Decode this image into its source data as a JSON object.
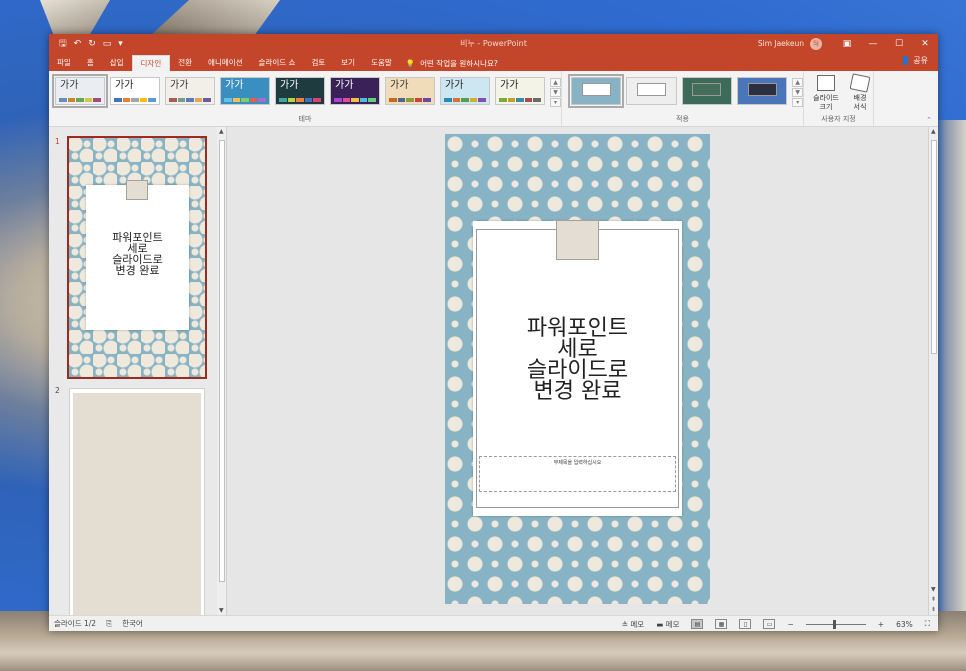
{
  "window": {
    "doc_title": "비누  -  PowerPoint",
    "user_name": "Sim Jaekeun",
    "user_initials": "SJ",
    "qat": [
      "save-icon",
      "undo-icon",
      "redo-icon",
      "present-icon",
      "customize-icon"
    ],
    "controls": [
      "ribbon-display-icon",
      "minimize-icon",
      "maximize-icon",
      "close-icon"
    ]
  },
  "tabs": [
    {
      "label": "파일",
      "active": false
    },
    {
      "label": "홈",
      "active": false
    },
    {
      "label": "삽입",
      "active": false
    },
    {
      "label": "디자인",
      "active": true
    },
    {
      "label": "전환",
      "active": false
    },
    {
      "label": "애니메이션",
      "active": false
    },
    {
      "label": "슬라이드 쇼",
      "active": false
    },
    {
      "label": "검토",
      "active": false
    },
    {
      "label": "보기",
      "active": false
    },
    {
      "label": "도움말",
      "active": false
    }
  ],
  "tell_me": "어떤 작업을 원하시나요?",
  "share": "공유",
  "ribbon": {
    "themes_label": "테마",
    "variants_label": "적용",
    "customize_label": "사용자 지정",
    "theme_thumb_text": "가가",
    "themes": [
      {
        "bg": "#eaeef2",
        "fg": "#333333",
        "sw": [
          "#6a8fb5",
          "#c6862b",
          "#6aa35a",
          "#d0c94a",
          "#a04c7a"
        ]
      },
      {
        "bg": "#ffffff",
        "fg": "#222222",
        "sw": [
          "#4472c4",
          "#ed7d31",
          "#a5a5a5",
          "#ffc000",
          "#5b9bd5"
        ]
      },
      {
        "bg": "#f2efe9",
        "fg": "#333333",
        "sw": [
          "#a65d57",
          "#7b9c8a",
          "#5a7bb5",
          "#e0a94d",
          "#6a5d9c"
        ]
      },
      {
        "bg": "#3a8fc0",
        "fg": "#ffffff",
        "sw": [
          "#63c0e6",
          "#f0c050",
          "#7ad06a",
          "#e06050",
          "#a070d0"
        ]
      },
      {
        "bg": "#1e3b40",
        "fg": "#ffffff",
        "sw": [
          "#3fa7a0",
          "#c0d040",
          "#f08040",
          "#4070c0",
          "#e04070"
        ]
      },
      {
        "bg": "#3a2157",
        "fg": "#ffffff",
        "sw": [
          "#a24ac9",
          "#e04aa0",
          "#f0c040",
          "#4ac0e0",
          "#60d080"
        ]
      },
      {
        "bg": "#f0dcb8",
        "fg": "#333333",
        "sw": [
          "#c06a2a",
          "#4a6a8a",
          "#8a9a40",
          "#d04040",
          "#6a4aa0"
        ]
      },
      {
        "bg": "#cce6f2",
        "fg": "#222222",
        "sw": [
          "#2a8ab0",
          "#e07030",
          "#50a050",
          "#d0b030",
          "#8050b0"
        ]
      },
      {
        "bg": "#f3f3e7",
        "fg": "#222222",
        "sw": [
          "#7aaa3a",
          "#c0a030",
          "#3a8ab0",
          "#b04a4a",
          "#6a6a6a"
        ]
      }
    ],
    "variants": [
      {
        "bg": "#87b3c4",
        "inner": "#ffffff"
      },
      {
        "bg": "#eeeeee",
        "inner": "#ffffff"
      },
      {
        "bg": "#3d6b5a",
        "inner": "#456e58"
      },
      {
        "bg": "#4a75b8",
        "inner": "#2c2f40"
      }
    ],
    "slide_size_label": "슬라이드\n크기",
    "format_bg_label": "배경\n서식"
  },
  "slides": [
    {
      "number": "1",
      "title": "파워포인트\n세로\n슬라이드로\n변경 완료",
      "selected": true
    },
    {
      "number": "2",
      "title": "",
      "selected": false
    }
  ],
  "main_slide": {
    "title": "파워포인트\n세로\n슬라이드로\n변경 완료",
    "subtitle_placeholder": "부제목을 입력하십시오"
  },
  "status": {
    "slide_counter": "슬라이드 1/2",
    "language": "한국어",
    "notes": "메모",
    "comments": "메모",
    "zoom": "63%",
    "zoom_value": 63
  }
}
